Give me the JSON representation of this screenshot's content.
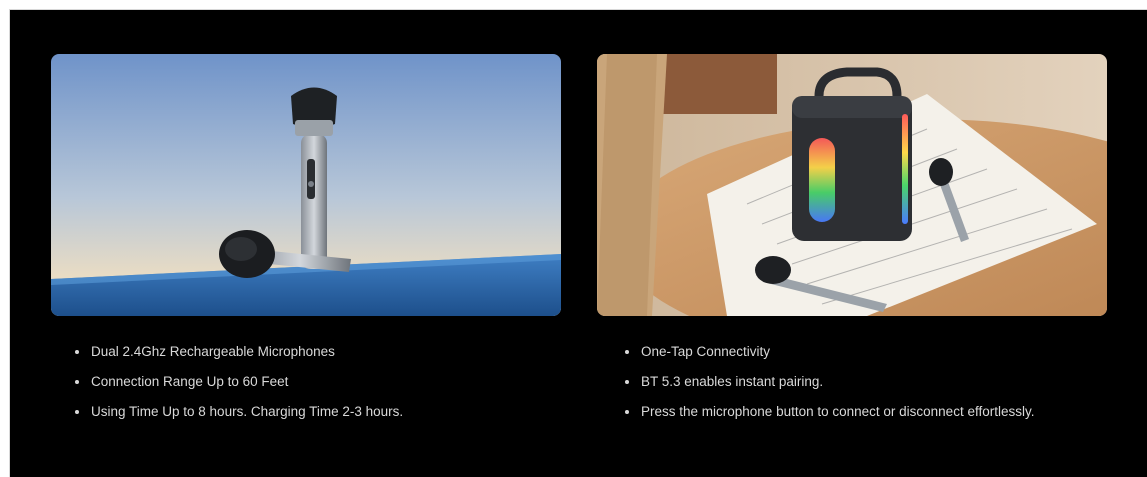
{
  "panels": [
    {
      "image": "wireless-microphones-photo",
      "features": [
        "Dual 2.4Ghz Rechargeable Microphones",
        "Connection Range Up to 60 Feet",
        "Using Time Up to 8 hours. Charging Time 2-3 hours."
      ]
    },
    {
      "image": "karaoke-speaker-with-microphones-photo",
      "features": [
        "One-Tap Connectivity",
        "BT 5.3 enables instant pairing.",
        "Press the microphone button to connect or disconnect effortlessly."
      ]
    }
  ],
  "colors": {
    "background": "#000000",
    "text": "#d9d9d9",
    "page": "#ffffff"
  }
}
